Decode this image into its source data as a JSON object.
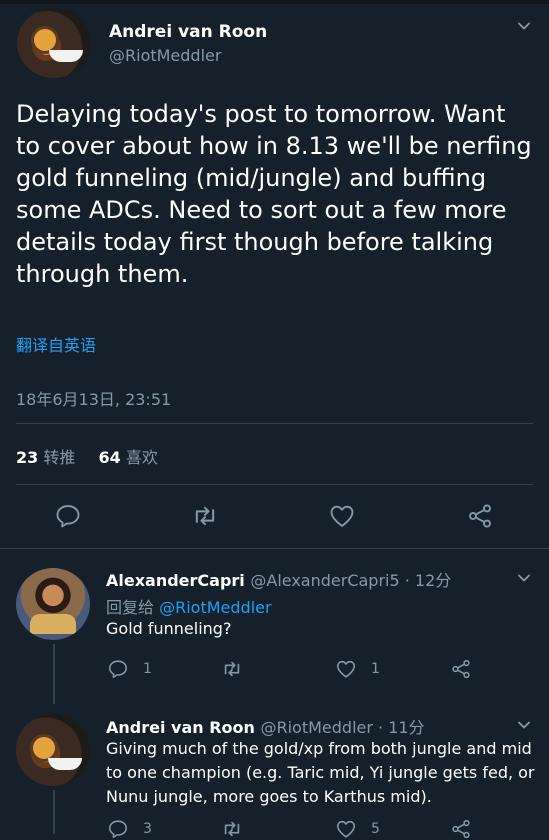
{
  "tweet": {
    "author_name": "Andrei van Roon",
    "author_handle": "@RiotMeddler",
    "text": "Delaying today's post to tomorrow. Want\nto cover about how in 8.13 we'll be nerfing\ngold funneling (mid/jungle) and buffing\nsome ADCs. Need to sort out a few more\ndetails today first though before talking\nthrough them.",
    "translate_link": "翻译自英语",
    "timestamp": "18年6月13日, 23:51",
    "retweets_count": "23",
    "retweets_label": "转推",
    "likes_count": "64",
    "likes_label": "喜欢"
  },
  "replies": [
    {
      "author_name": "AlexanderCapri",
      "meta": "@AlexanderCapri5 · 12分",
      "reply_prefix": "回复给",
      "reply_mention": "@RiotMeddler",
      "text": "Gold funneling?",
      "reply_count": "1",
      "retweet_count": "",
      "like_count": "1"
    },
    {
      "author_name": "Andrei van Roon",
      "meta": "@RiotMeddler · 11分",
      "text": "Giving much of the gold/xp from both jungle and mid to one champion (e.g. Taric mid, Yi jungle gets fed, or Nunu jungle, more goes to Karthus mid).",
      "reply_count": "3",
      "like_count": "5"
    }
  ],
  "icons": {
    "reply": "reply-icon",
    "retweet": "retweet-icon",
    "like": "heart-icon",
    "share": "share-icon",
    "menu": "chevron-down-icon"
  },
  "colors": {
    "background": "#15202b",
    "accent": "#1da1f2",
    "muted": "#8899a6",
    "divider": "#38444d"
  }
}
